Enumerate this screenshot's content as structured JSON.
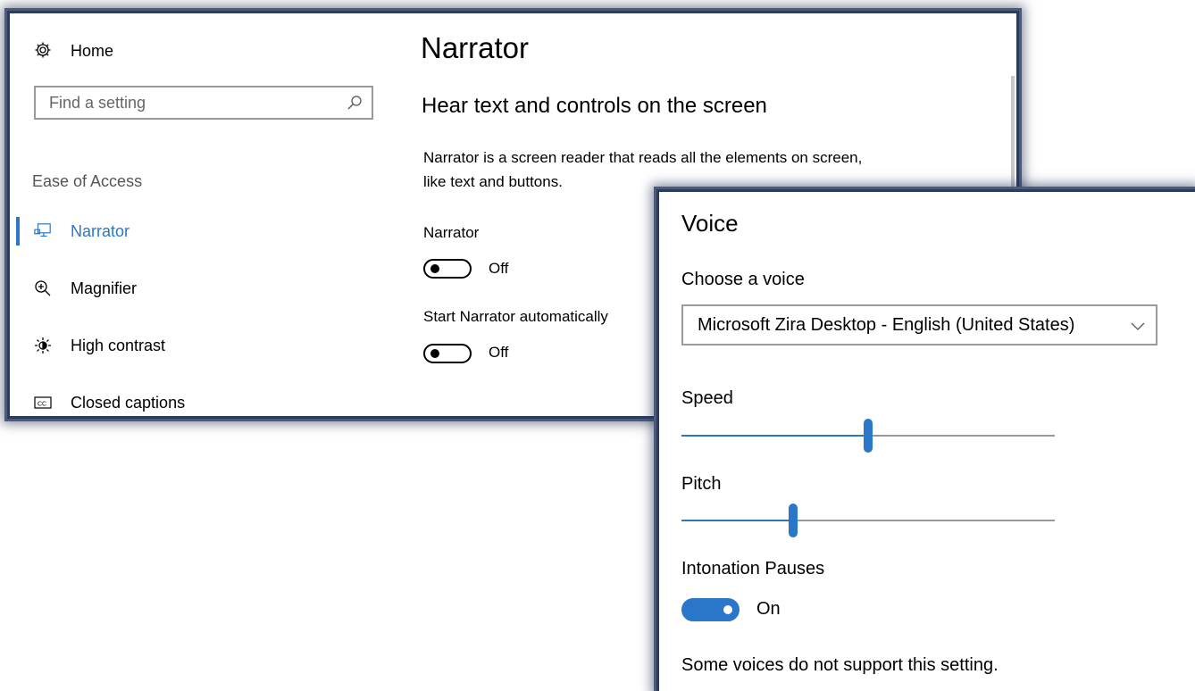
{
  "settings": {
    "home_label": "Home",
    "search_placeholder": "Find a setting",
    "section_label": "Ease of Access",
    "nav": [
      {
        "label": "Narrator",
        "icon": "narrator-icon",
        "selected": true
      },
      {
        "label": "Magnifier",
        "icon": "magnifier-icon",
        "selected": false
      },
      {
        "label": "High contrast",
        "icon": "high-contrast-icon",
        "selected": false
      },
      {
        "label": "Closed captions",
        "icon": "closed-captions-icon",
        "selected": false
      }
    ],
    "page_title": "Narrator",
    "subtitle": "Hear text and controls on the screen",
    "description_line1": "Narrator is a screen reader that reads all the elements on screen,",
    "description_line2": "like text and buttons.",
    "narrator_toggle": {
      "label": "Narrator",
      "state": "Off"
    },
    "auto_toggle": {
      "label": "Start Narrator automatically",
      "state": "Off"
    }
  },
  "voice": {
    "title": "Voice",
    "choose_label": "Choose a voice",
    "selected_voice": "Microsoft Zira Desktop - English (United States)",
    "speed": {
      "label": "Speed",
      "value": 0.5
    },
    "pitch": {
      "label": "Pitch",
      "value": 0.3
    },
    "intonation": {
      "label": "Intonation Pauses",
      "state": "On"
    },
    "note": "Some voices do not support this setting."
  },
  "colors": {
    "accent": "#2a76c9",
    "frame": "#2b3c5e"
  }
}
